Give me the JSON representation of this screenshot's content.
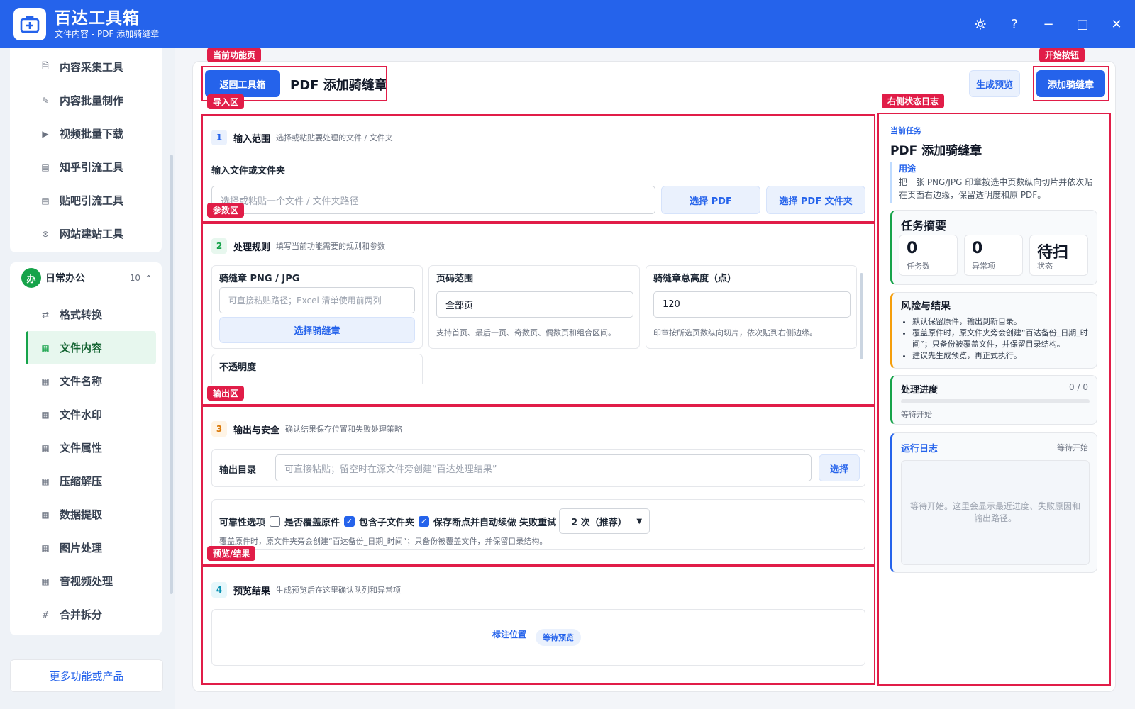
{
  "app": {
    "name": "百达工具箱",
    "subtitle": "文件内容 - PDF 添加骑缝章"
  },
  "window": {
    "settings_icon": "gear-icon",
    "help": "?",
    "minimize": "−",
    "maximize": "□",
    "close": "✕"
  },
  "sidebar": {
    "group1_items": [
      {
        "label": "内容采集工具",
        "icon": "🗎"
      },
      {
        "label": "内容批量制作",
        "icon": "✎"
      },
      {
        "label": "视频批量下载",
        "icon": "▶"
      },
      {
        "label": "知乎引流工具",
        "icon": "▤"
      },
      {
        "label": "贴吧引流工具",
        "icon": "▤"
      },
      {
        "label": "网站建站工具",
        "icon": "⊗"
      }
    ],
    "group2": {
      "badge": "办",
      "title": "日常办公",
      "count": "10",
      "caret": "^",
      "items": [
        {
          "label": "格式转换",
          "icon": "⇄"
        },
        {
          "label": "文件内容",
          "icon": "▦"
        },
        {
          "label": "文件名称",
          "icon": "▦"
        },
        {
          "label": "文件水印",
          "icon": "▦"
        },
        {
          "label": "文件属性",
          "icon": "▦"
        },
        {
          "label": "压缩解压",
          "icon": "▦"
        },
        {
          "label": "数据提取",
          "icon": "▦"
        },
        {
          "label": "图片处理",
          "icon": "▦"
        },
        {
          "label": "音视频处理",
          "icon": "▦"
        },
        {
          "label": "合并拆分",
          "icon": "#"
        }
      ]
    },
    "more": "更多功能或产品"
  },
  "annotations": {
    "current_page": "当前功能页",
    "start_button": "开始按钮",
    "import_area": "导入区",
    "right_log": "右侧状态日志",
    "param_area": "参数区",
    "output_area": "输出区",
    "preview_area": "预览/结果"
  },
  "header": {
    "back": "返回工具箱",
    "title": "PDF 添加骑缝章",
    "preview": "生成预览",
    "start": "添加骑缝章"
  },
  "section1": {
    "step": "1",
    "title": "输入范围",
    "desc": "选择或粘贴要处理的文件 / 文件夹",
    "field_label": "输入文件或文件夹",
    "placeholder": "选择或粘贴一个文件 / 文件夹路径",
    "choose_pdf": "选择 PDF",
    "choose_folder": "选择 PDF 文件夹"
  },
  "section2": {
    "step": "2",
    "title": "处理规则",
    "desc": "填写当前功能需要的规则和参数",
    "stamp_label": "骑缝章 PNG / JPG",
    "stamp_placeholder": "可直接粘贴路径；Excel 清单使用前两列",
    "stamp_button": "选择骑缝章",
    "page_label": "页码范围",
    "page_value": "全部页",
    "page_hint": "支持首页、最后一页、奇数页、偶数页和组合区间。",
    "height_label": "骑缝章总高度（点）",
    "height_value": "120",
    "height_hint": "印章按所选页数纵向切片，依次贴到右侧边缘。",
    "opacity_label": "不透明度"
  },
  "section3": {
    "step": "3",
    "title": "输出与安全",
    "desc": "确认结果保存位置和失败处理策略",
    "dir_label": "输出目录",
    "dir_placeholder": "可直接粘贴；留空时在源文件旁创建“百达处理结果”",
    "dir_button": "选择",
    "reliability_label": "可靠性选项",
    "overwrite": "是否覆盖原件",
    "subfolders": "包含子文件夹",
    "resume": "保存断点并自动续做",
    "retry_label": "失败重试",
    "retry_value": "2 次（推荐）",
    "note": "覆盖原件时，原文件夹旁会创建“百达备份_日期_时间”；只备份被覆盖文件，并保留目录结构。"
  },
  "section4": {
    "step": "4",
    "title": "预览结果",
    "desc": "生成预览后在这里确认队列和异常项",
    "mark_label": "标注位置",
    "status": "等待预览"
  },
  "right": {
    "task_label": "当前任务",
    "task_title": "PDF 添加骑缝章",
    "purpose_label": "用途",
    "purpose_text": "把一张 PNG/JPG 印章按选中页数纵向切片并依次贴在页面右边缘，保留透明度和原 PDF。",
    "summary_title": "任务摘要",
    "stats": [
      {
        "value": "0",
        "label": "任务数"
      },
      {
        "value": "0",
        "label": "异常项"
      },
      {
        "value": "待扫",
        "label": "状态"
      }
    ],
    "risk_title": "风险与结果",
    "risks": [
      "默认保留原件，输出到新目录。",
      "覆盖原件时，原文件夹旁会创建“百达备份_日期_时间”；只备份被覆盖文件，并保留目录结构。",
      "建议先生成预览，再正式执行。"
    ],
    "progress_title": "处理进度",
    "progress_count": "0 / 0",
    "progress_fraction": 0,
    "progress_status": "等待开始",
    "log_title": "运行日志",
    "log_status": "等待开始",
    "log_text": "等待开始。这里会显示最近进度、失败原因和输出路径。"
  },
  "colors": {
    "brand": "#2563eb",
    "annotation": "#e11d48",
    "active_green": "#16a34a"
  }
}
